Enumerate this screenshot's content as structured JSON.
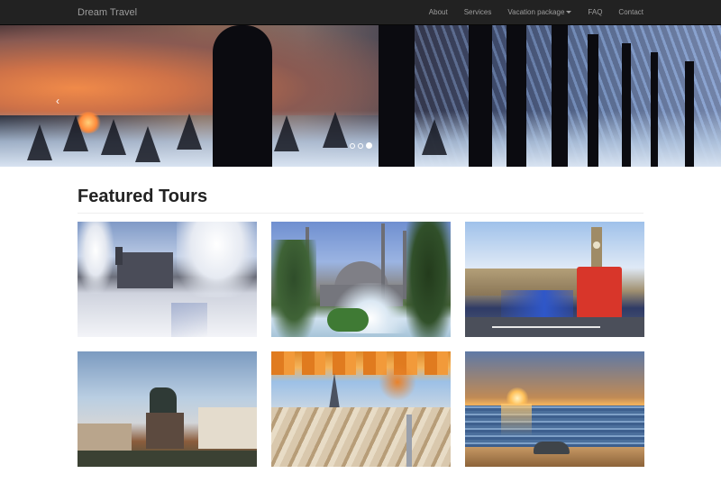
{
  "navbar": {
    "brand": "Dream Travel",
    "items": [
      {
        "label": "About"
      },
      {
        "label": "Services"
      },
      {
        "label": "Vacation package"
      },
      {
        "label": "FAQ"
      },
      {
        "label": "Contact"
      }
    ]
  },
  "carousel": {
    "prev_glyph": "‹",
    "indicator_count": 3,
    "active_index": 2
  },
  "featured": {
    "title": "Featured Tours"
  },
  "colors": {
    "navbar_bg": "#222222",
    "navbar_text": "#9d9d9d",
    "heading": "#222222"
  },
  "icons": {
    "carousel_prev": "chevron-left-icon",
    "dropdown": "caret-down-icon"
  }
}
